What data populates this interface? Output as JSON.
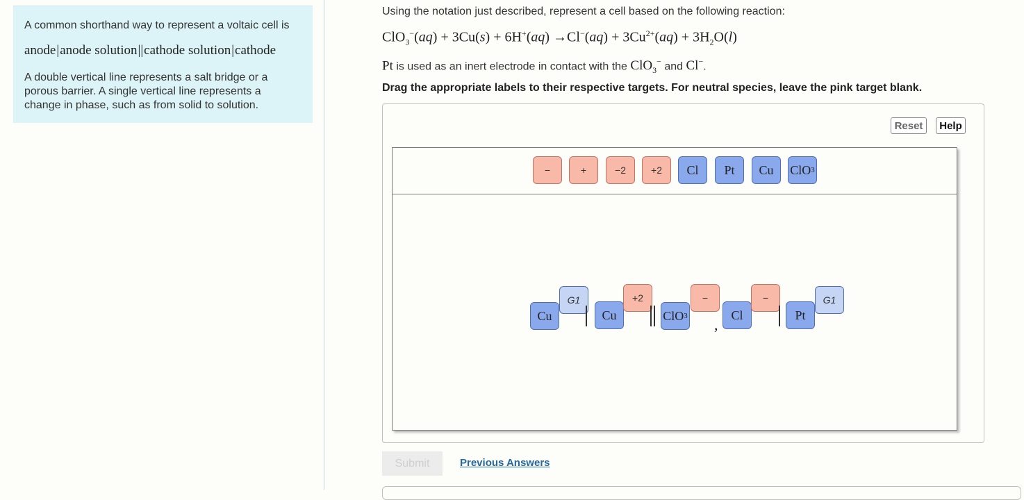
{
  "info": {
    "intro": "A common shorthand way to represent a voltaic cell is",
    "notation": {
      "anode": "anode",
      "anode_solution": "anode solution",
      "cathode_solution": "cathode solution",
      "cathode": "cathode"
    },
    "description": "A double vertical line represents a salt bridge or a porous barrier. A single vertical line represents a change in phase, such as from solid to solution."
  },
  "question": {
    "intro": "Using the notation just described, represent a cell based on the following reaction:",
    "pt_sentence_parts": [
      "is used as an inert electrode in contact with the",
      "and",
      "."
    ],
    "instruction": "Drag the appropriate labels to their respective targets. For neutral species, leave the pink target blank."
  },
  "toolbar": {
    "reset_label": "Reset",
    "help_label": "Help"
  },
  "label_bank": [
    {
      "id": "minus",
      "text": "−",
      "kind": "charge"
    },
    {
      "id": "plus",
      "text": "+",
      "kind": "charge"
    },
    {
      "id": "minus2",
      "text": "−2",
      "kind": "charge"
    },
    {
      "id": "plus2",
      "text": "+2",
      "kind": "charge"
    },
    {
      "id": "cl",
      "text": "Cl",
      "kind": "species"
    },
    {
      "id": "pt",
      "text": "Pt",
      "kind": "species"
    },
    {
      "id": "cu",
      "text": "Cu",
      "kind": "species"
    },
    {
      "id": "clo3",
      "text": "ClO",
      "sub": "3",
      "kind": "species"
    }
  ],
  "placed": {
    "anode_electrode": "Cu",
    "anode_group": "G1",
    "anode_ion": "Cu",
    "anode_ion_charge": "+2",
    "cathode_ion1": "ClO",
    "cathode_ion1_sub": "3",
    "cathode_ion1_charge": "−",
    "comma": ",",
    "cathode_ion2": "Cl",
    "cathode_ion2_charge": "−",
    "cathode_electrode": "Pt",
    "cathode_group": "G1"
  },
  "actions": {
    "submit_label": "Submit",
    "previous_answers_label": "Previous Answers"
  },
  "colors": {
    "info_bg": "#dcf4f7",
    "charge_tile": "#f8b9a9",
    "species_tile": "#8aa9ec",
    "group_tile": "#c6d5f3",
    "link": "#2468a2"
  }
}
